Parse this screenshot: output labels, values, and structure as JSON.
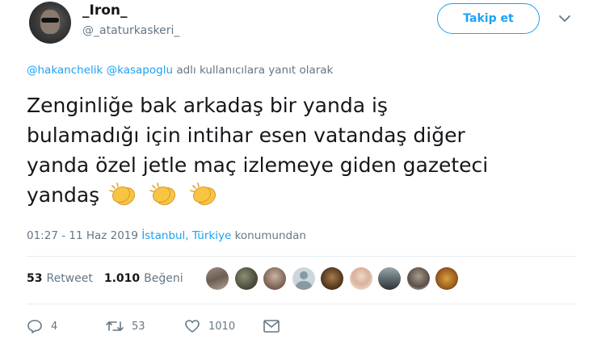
{
  "author": {
    "name": "_Iron_",
    "handle": "@_ataturkaskeri_"
  },
  "header": {
    "follow_label": "Takip et"
  },
  "reply": {
    "mention1": "@hakanchelik",
    "mention2": "@kasapoglu",
    "suffix": "adlı kullanıcılara yanıt olarak"
  },
  "tweet": {
    "line1": "Zenginliğe bak arkadaş bir yanda iş",
    "line2": "bulamadığı için intihar esen vatandaş diğer",
    "line3": "yanda özel jetle maç izlemeye giden gazeteci",
    "line4": "yandaş",
    "emoji": [
      "clapping-hands",
      "clapping-hands",
      "clapping-hands"
    ]
  },
  "meta": {
    "time": "01:27 - 11 Haz 2019",
    "location": "İstanbul, Türkiye",
    "location_suffix": "konumundan"
  },
  "stats": {
    "retweet_count": "53",
    "retweet_label": "Retweet",
    "like_count": "1.010",
    "like_label": "Beğeni"
  },
  "likers": [
    "liker-avatar-1",
    "liker-avatar-2",
    "liker-avatar-3",
    "liker-avatar-4",
    "liker-avatar-5",
    "liker-avatar-6",
    "liker-avatar-7",
    "liker-avatar-8",
    "liker-avatar-9"
  ],
  "actions": {
    "reply_count": "4",
    "retweet_count": "53",
    "like_count": "1010"
  },
  "colors": {
    "accent": "#1da1f2",
    "muted": "#657786",
    "text": "#14171a"
  }
}
